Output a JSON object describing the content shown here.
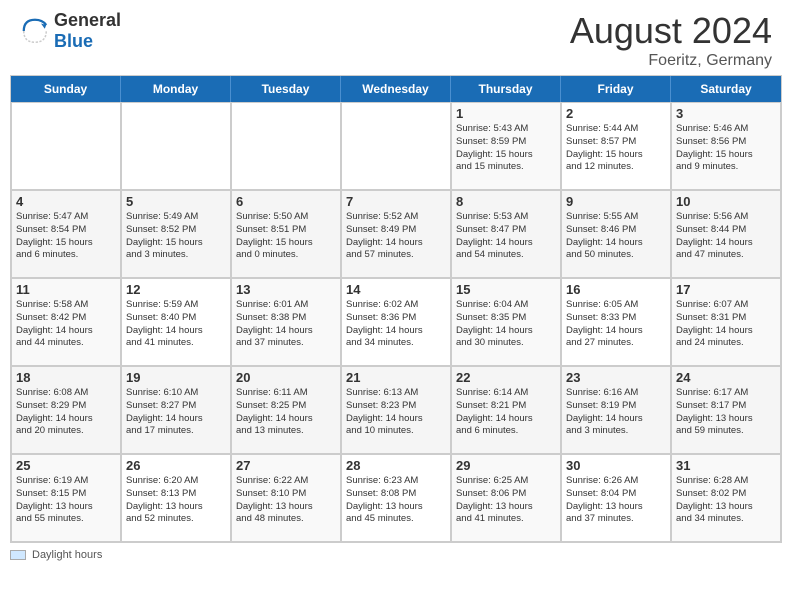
{
  "header": {
    "logo_general": "General",
    "logo_blue": "Blue",
    "month_title": "August 2024",
    "location": "Foeritz, Germany"
  },
  "day_headers": [
    "Sunday",
    "Monday",
    "Tuesday",
    "Wednesday",
    "Thursday",
    "Friday",
    "Saturday"
  ],
  "footer": {
    "label": "Daylight hours"
  },
  "weeks": [
    {
      "days": [
        {
          "num": "",
          "info": ""
        },
        {
          "num": "",
          "info": ""
        },
        {
          "num": "",
          "info": ""
        },
        {
          "num": "",
          "info": ""
        },
        {
          "num": "1",
          "info": "Sunrise: 5:43 AM\nSunset: 8:59 PM\nDaylight: 15 hours\nand 15 minutes."
        },
        {
          "num": "2",
          "info": "Sunrise: 5:44 AM\nSunset: 8:57 PM\nDaylight: 15 hours\nand 12 minutes."
        },
        {
          "num": "3",
          "info": "Sunrise: 5:46 AM\nSunset: 8:56 PM\nDaylight: 15 hours\nand 9 minutes."
        }
      ]
    },
    {
      "days": [
        {
          "num": "4",
          "info": "Sunrise: 5:47 AM\nSunset: 8:54 PM\nDaylight: 15 hours\nand 6 minutes."
        },
        {
          "num": "5",
          "info": "Sunrise: 5:49 AM\nSunset: 8:52 PM\nDaylight: 15 hours\nand 3 minutes."
        },
        {
          "num": "6",
          "info": "Sunrise: 5:50 AM\nSunset: 8:51 PM\nDaylight: 15 hours\nand 0 minutes."
        },
        {
          "num": "7",
          "info": "Sunrise: 5:52 AM\nSunset: 8:49 PM\nDaylight: 14 hours\nand 57 minutes."
        },
        {
          "num": "8",
          "info": "Sunrise: 5:53 AM\nSunset: 8:47 PM\nDaylight: 14 hours\nand 54 minutes."
        },
        {
          "num": "9",
          "info": "Sunrise: 5:55 AM\nSunset: 8:46 PM\nDaylight: 14 hours\nand 50 minutes."
        },
        {
          "num": "10",
          "info": "Sunrise: 5:56 AM\nSunset: 8:44 PM\nDaylight: 14 hours\nand 47 minutes."
        }
      ]
    },
    {
      "days": [
        {
          "num": "11",
          "info": "Sunrise: 5:58 AM\nSunset: 8:42 PM\nDaylight: 14 hours\nand 44 minutes."
        },
        {
          "num": "12",
          "info": "Sunrise: 5:59 AM\nSunset: 8:40 PM\nDaylight: 14 hours\nand 41 minutes."
        },
        {
          "num": "13",
          "info": "Sunrise: 6:01 AM\nSunset: 8:38 PM\nDaylight: 14 hours\nand 37 minutes."
        },
        {
          "num": "14",
          "info": "Sunrise: 6:02 AM\nSunset: 8:36 PM\nDaylight: 14 hours\nand 34 minutes."
        },
        {
          "num": "15",
          "info": "Sunrise: 6:04 AM\nSunset: 8:35 PM\nDaylight: 14 hours\nand 30 minutes."
        },
        {
          "num": "16",
          "info": "Sunrise: 6:05 AM\nSunset: 8:33 PM\nDaylight: 14 hours\nand 27 minutes."
        },
        {
          "num": "17",
          "info": "Sunrise: 6:07 AM\nSunset: 8:31 PM\nDaylight: 14 hours\nand 24 minutes."
        }
      ]
    },
    {
      "days": [
        {
          "num": "18",
          "info": "Sunrise: 6:08 AM\nSunset: 8:29 PM\nDaylight: 14 hours\nand 20 minutes."
        },
        {
          "num": "19",
          "info": "Sunrise: 6:10 AM\nSunset: 8:27 PM\nDaylight: 14 hours\nand 17 minutes."
        },
        {
          "num": "20",
          "info": "Sunrise: 6:11 AM\nSunset: 8:25 PM\nDaylight: 14 hours\nand 13 minutes."
        },
        {
          "num": "21",
          "info": "Sunrise: 6:13 AM\nSunset: 8:23 PM\nDaylight: 14 hours\nand 10 minutes."
        },
        {
          "num": "22",
          "info": "Sunrise: 6:14 AM\nSunset: 8:21 PM\nDaylight: 14 hours\nand 6 minutes."
        },
        {
          "num": "23",
          "info": "Sunrise: 6:16 AM\nSunset: 8:19 PM\nDaylight: 14 hours\nand 3 minutes."
        },
        {
          "num": "24",
          "info": "Sunrise: 6:17 AM\nSunset: 8:17 PM\nDaylight: 13 hours\nand 59 minutes."
        }
      ]
    },
    {
      "days": [
        {
          "num": "25",
          "info": "Sunrise: 6:19 AM\nSunset: 8:15 PM\nDaylight: 13 hours\nand 55 minutes."
        },
        {
          "num": "26",
          "info": "Sunrise: 6:20 AM\nSunset: 8:13 PM\nDaylight: 13 hours\nand 52 minutes."
        },
        {
          "num": "27",
          "info": "Sunrise: 6:22 AM\nSunset: 8:10 PM\nDaylight: 13 hours\nand 48 minutes."
        },
        {
          "num": "28",
          "info": "Sunrise: 6:23 AM\nSunset: 8:08 PM\nDaylight: 13 hours\nand 45 minutes."
        },
        {
          "num": "29",
          "info": "Sunrise: 6:25 AM\nSunset: 8:06 PM\nDaylight: 13 hours\nand 41 minutes."
        },
        {
          "num": "30",
          "info": "Sunrise: 6:26 AM\nSunset: 8:04 PM\nDaylight: 13 hours\nand 37 minutes."
        },
        {
          "num": "31",
          "info": "Sunrise: 6:28 AM\nSunset: 8:02 PM\nDaylight: 13 hours\nand 34 minutes."
        }
      ]
    }
  ]
}
